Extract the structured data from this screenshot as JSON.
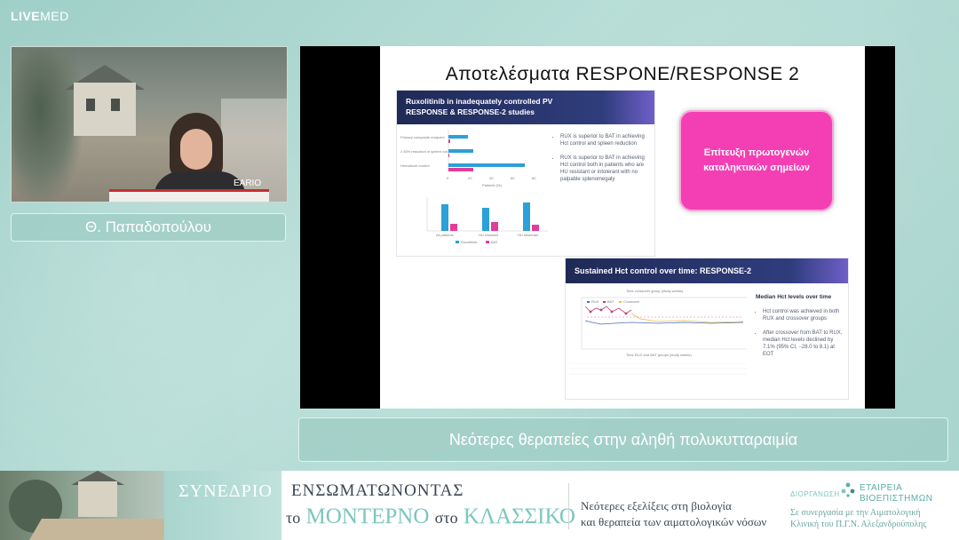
{
  "brand": {
    "live": "LIVE",
    "med": "MED"
  },
  "speaker": {
    "name": "Θ. Παπαδοπούλου",
    "podium_text": "EARIO"
  },
  "slide": {
    "title": "Αποτελέσματα RESPONE/RESPONSE 2",
    "panel1": {
      "header_line1": "Ruxolitinib in inadequately controlled PV",
      "header_line2": "RESPONSE & RESPONSE-2 studies",
      "bar_labels": [
        "Primary composite endpoint",
        "≥ 35% reduction in spleen volume",
        "Hematocrit control"
      ],
      "x_ticks": [
        "0",
        "20",
        "40",
        "60",
        "80"
      ],
      "x_label": "Patients (%)",
      "group_labels": [
        "All patients",
        "HU resistant",
        "HU intolerant"
      ],
      "legend": [
        "Ruxolitinib",
        "BAT"
      ],
      "bullets": [
        "RUX is superior to BAT in achieving Hct control and spleen reduction",
        "RUX is superior to BAT in achieving Hct control both in patients who are HU resistant or intolerant with no palpable splenomegaly"
      ]
    },
    "panel2": {
      "header": "Sustained Hct control over time: RESPONSE-2",
      "top_axis_label": "Time crossover group (study weeks)",
      "bottom_axis_label": "Time RUX and BAT groups (study weeks)",
      "legend": [
        "RUX",
        "BAT",
        "Crossover"
      ],
      "bullet_head": "Median Hct levels over time",
      "bullets": [
        "Hct control was achieved in both RUX and crossover groups",
        "After crossover from BAT to RUX, median Hct levels declined by 7.1% (95% CI, −28.0 to 8.1) at EOT"
      ]
    },
    "callout": "Επίτευξη πρωτογενών καταληκτικών σημείων"
  },
  "caption": "Νεότερες θεραπείες στην αληθή πολυκυτταραιμία",
  "banner": {
    "synedrio": "ΣΥΝΕΔΡΙΟ",
    "line1": "ΕΝΣΩΜΑΤΩΝΟΝΤΑΣ",
    "line2_a": "το",
    "line2_b": "ΜΟΝΤΕΡΝΟ",
    "line2_c": "στο",
    "line2_d": "ΚΛΑΣΣΙΚΟ",
    "sub1": "Νεότερες εξελίξεις στη βιολογία",
    "sub2": "και θεραπεία των αιματολογικών νόσων",
    "org_label": "ΔΙΟΡΓΑΝΩΣΗ",
    "org_name1": "ΕΤΑΙΡΕΙΑ",
    "org_name2": "ΒΙΟΕΠΙΣΤΗΜΩΝ",
    "co1": "Σε συνεργασία με την Αιματολογική",
    "co2": "Κλινική του Π.Γ.Ν. Αλεξανδρούπολης"
  },
  "colors": {
    "accent": "#f43fb4",
    "teal": "#a0cec6",
    "rux": "#2ca0d8",
    "bat": "#e23d9a"
  }
}
